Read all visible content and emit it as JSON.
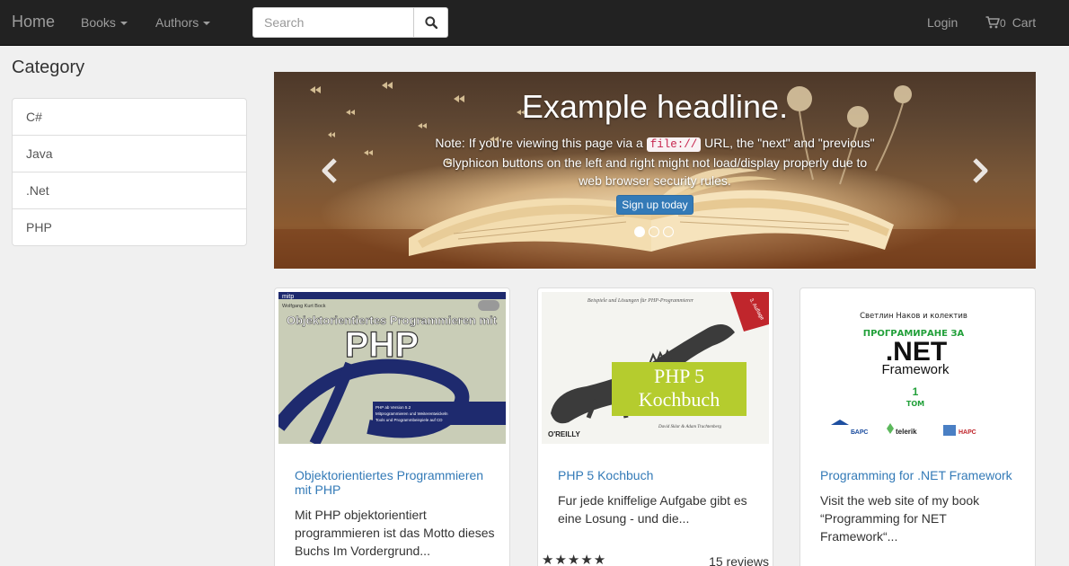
{
  "navbar": {
    "brand": "Home",
    "menus": [
      {
        "label": "Books"
      },
      {
        "label": "Authors"
      }
    ],
    "search": {
      "placeholder": "Search",
      "value": ""
    },
    "login": "Login",
    "cart": {
      "count": "0",
      "label": "Cart"
    }
  },
  "sidebar": {
    "title": "Category",
    "items": [
      "C#",
      "Java",
      ".Net",
      "PHP"
    ]
  },
  "carousel": {
    "headline": "Example headline.",
    "note_before": "Note: If you're viewing this page via a",
    "note_code": "file://",
    "note_after": "URL, the \"next\" and \"previous\" Glyphicon buttons on the left and right might not load/display properly due to web browser security rules.",
    "button": "Sign up today",
    "slide_count": 3,
    "active_slide": 1
  },
  "books": [
    {
      "title": "Objektorientiertes Programmieren mit PHP",
      "description": "Mit PHP objektorientiert programmieren ist das Motto dieses Buchs Im Vordergrund...",
      "cover": {
        "publisher": "mitp",
        "author": "Wolfgang Kurt Bock",
        "heading": "Objektorientiertes Programmieren mit",
        "big_text": "PHP",
        "line1": "PHP ab Version 5.2",
        "line2": "Mitprogrammieren und Weiterentwickeln",
        "line3": "Tools und Programmbeispiele auf CD"
      }
    },
    {
      "title": "PHP 5 Kochbuch",
      "description": "Fur jede kniffelige Aufgabe gibt es eine Losung - und die...",
      "rating": "★★★★★",
      "reviews": "15 reviews",
      "cover": {
        "subtitle": "Beispiele und Lösungen für PHP-Programmierer",
        "edition": "3. Auflage",
        "big_line1": "PHP 5",
        "big_line2": "Kochbuch",
        "publisher": "O'REILLY",
        "authors": "David Sklar & Adam Trachtenberg"
      }
    },
    {
      "title": "Programming for .NET Framework",
      "description": "Visit the web site of my book “Programming for NET Framework“...",
      "cover": {
        "authors": "Светлин Наков  и  колектив",
        "heading": "ПРОГРАМИРАНЕ ЗА",
        "big": ".NET",
        "framework": "Framework",
        "volume_num": "1",
        "volume": "ТОМ",
        "logo1": "БАРС",
        "logo2": "telerik",
        "logo3": "НАРС"
      }
    }
  ],
  "colors": {
    "navbar": "#222222",
    "link": "#337ab7",
    "primary_button": "#337ab7",
    "kochbuch_green": "#b5cc2e",
    "net_green": "#22a03a"
  }
}
